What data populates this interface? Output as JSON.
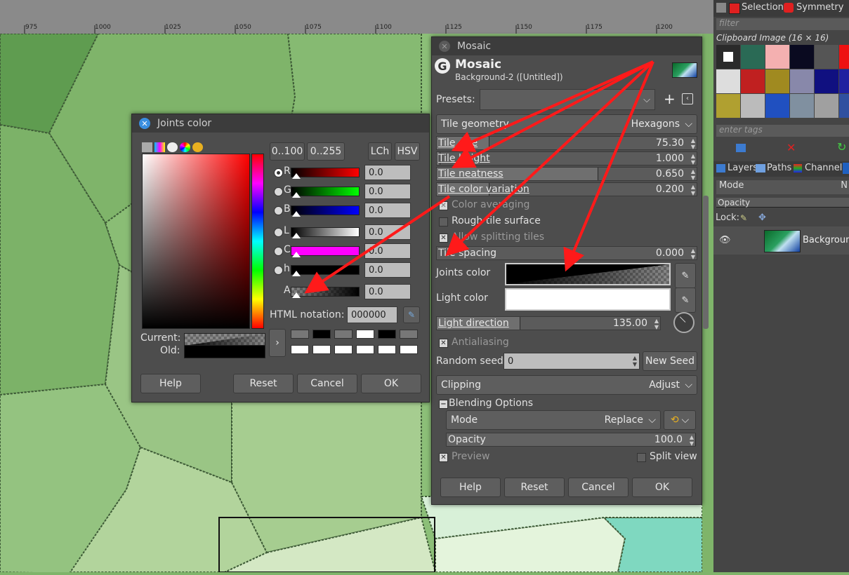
{
  "ruler": {
    "labels": [
      "975",
      "1000",
      "1025",
      "1050",
      "1075",
      "1100",
      "1125",
      "1150",
      "1175",
      "1200"
    ]
  },
  "colors": {
    "arrow": "#ff1a1a",
    "dialog_bg": "#4d4d4d",
    "canvas_green": "#7fb46a"
  },
  "right_panel": {
    "tab_selection": "Selection",
    "tab_symmetry": "Symmetry",
    "filter_placeholder": "filter",
    "clipboard_label": "Clipboard Image (16 × 16)",
    "tags_placeholder": "enter tags",
    "tab_layers": "Layers",
    "tab_paths": "Paths",
    "tab_channels": "Channels",
    "mode_label": "Mode",
    "mode_value": "N",
    "opacity_label": "Opacity",
    "lock_label": "Lock:",
    "layer_name": "Background"
  },
  "mosaic": {
    "window_title": "Mosaic",
    "header_title": "Mosaic",
    "header_sub": "Background-2 ([Untitled])",
    "presets_label": "Presets:",
    "add_icon": "+",
    "tile_geometry_label": "Tile geometry",
    "tile_geometry_value": "Hexagons",
    "sliders": [
      {
        "label": "Tile size",
        "value": "75.30",
        "fill": 0.2
      },
      {
        "label": "Tile height",
        "value": "1.000",
        "fill": 0.0
      },
      {
        "label": "Tile neatness",
        "value": "0.650",
        "fill": 0.65
      },
      {
        "label": "Tile color variation",
        "value": "0.200",
        "fill": 0.2
      }
    ],
    "color_averaging": "Color averaging",
    "rough_tile": "Rough tile surface",
    "allow_splitting": "Allow splitting tiles",
    "tile_spacing_label": "Tile spacing",
    "tile_spacing_value": "0.000",
    "joints_color_label": "Joints color",
    "light_color_label": "Light color",
    "light_direction_label": "Light direction",
    "light_direction_value": "135.00",
    "antialiasing": "Antialiasing",
    "random_seed_label": "Random seed",
    "random_seed_value": "0",
    "new_seed": "New Seed",
    "clipping_label": "Clipping",
    "clipping_value": "Adjust",
    "blending_options": "Blending Options",
    "mode_label": "Mode",
    "mode_value": "Replace",
    "opacity_label": "Opacity",
    "opacity_value": "100.0",
    "preview": "Preview",
    "split_view": "Split view",
    "help": "Help",
    "reset": "Reset",
    "cancel": "Cancel",
    "ok": "OK"
  },
  "joints": {
    "window_title": "Joints color",
    "range_100": "0..100",
    "range_255": "0..255",
    "lch": "LCh",
    "hsv": "HSV",
    "channels": [
      {
        "label": "R",
        "value": "0.0"
      },
      {
        "label": "G",
        "value": "0.0"
      },
      {
        "label": "B",
        "value": "0.0"
      },
      {
        "label": "L",
        "value": "0.0"
      },
      {
        "label": "C",
        "value": "0.0"
      },
      {
        "label": "h",
        "value": "0.0"
      },
      {
        "label": "A",
        "value": "0.0"
      }
    ],
    "html_label": "HTML notation:",
    "html_value": "000000",
    "current_label": "Current:",
    "old_label": "Old:",
    "help": "Help",
    "reset": "Reset",
    "cancel": "Cancel",
    "ok": "OK"
  }
}
